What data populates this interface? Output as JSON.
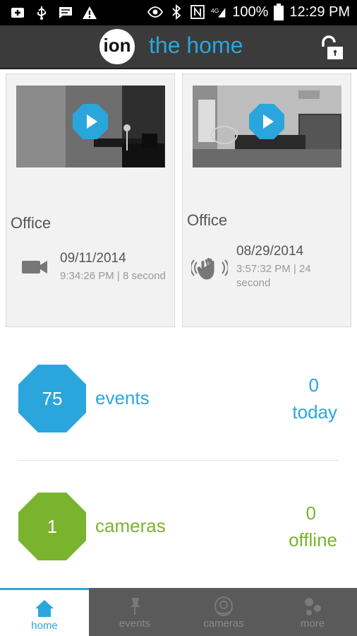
{
  "status_bar": {
    "battery": "100%",
    "time": "12:29 PM"
  },
  "app_bar": {
    "logo_text": "ion",
    "title": "the home"
  },
  "cards": [
    {
      "camera_name": "Office",
      "date": "09/11/2014",
      "time": "9:34:26 PM | 8 second",
      "event_icon": "camera-icon"
    },
    {
      "camera_name": "Office",
      "date": "08/29/2014",
      "time": "3:57:32 PM | 24 second",
      "event_icon": "motion-hand-icon"
    }
  ],
  "stats": {
    "events": {
      "count": "75",
      "label": "events",
      "today_count": "0",
      "today_label": "today"
    },
    "cameras": {
      "count": "1",
      "label": "cameras",
      "offline_count": "0",
      "offline_label": "offline"
    }
  },
  "tabs": [
    {
      "label": "home",
      "icon": "home-icon"
    },
    {
      "label": "events",
      "icon": "pin-icon"
    },
    {
      "label": "cameras",
      "icon": "camera-icon"
    },
    {
      "label": "more",
      "icon": "more-icon"
    }
  ],
  "colors": {
    "accent_blue": "#2aa6dd",
    "accent_green": "#7ab32e",
    "app_bar": "#3b3b3b",
    "tab_bar": "#5a5a5a"
  }
}
